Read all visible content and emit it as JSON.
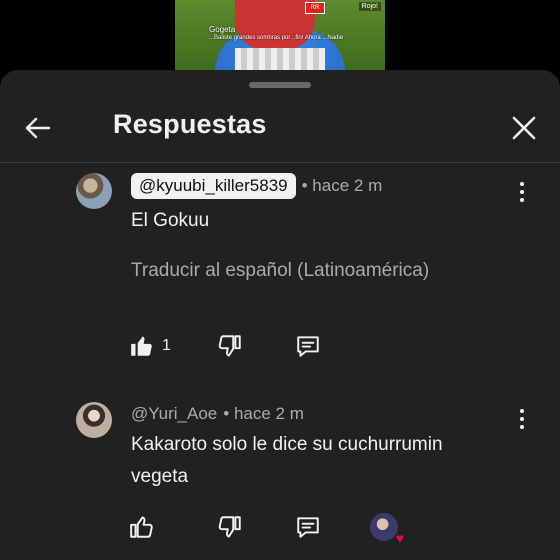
{
  "video": {
    "hud_name": "Gogeta",
    "hud_line": "...Baliste grandes sombras por ..fin! Ahora ...Nadie",
    "hud_tag": "Rojo!",
    "badge": "RR"
  },
  "header": {
    "title": "Respuestas",
    "back_icon": "arrow-left-icon",
    "close_icon": "close-icon"
  },
  "comments": [
    {
      "author": "@kyuubi_killer5839",
      "highlighted": true,
      "time": "• hace 2 m",
      "text": "El Gokuu",
      "translate": "Traducir al español (Latinoamérica)",
      "likes": "1",
      "liked": true
    },
    {
      "author": "@Yuri_Aoe",
      "highlighted": false,
      "time": "• hace 2 m",
      "text_line1": "Kakaroto solo le dice su cuchurrumin",
      "text_line2": "vegeta",
      "likes": "",
      "liked": false,
      "creator_heart": true
    }
  ],
  "colors": {
    "sheet_bg": "#212121",
    "text_primary": "#f1f1f1",
    "text_secondary": "#aaaaaa",
    "heart": "#e0112b"
  }
}
